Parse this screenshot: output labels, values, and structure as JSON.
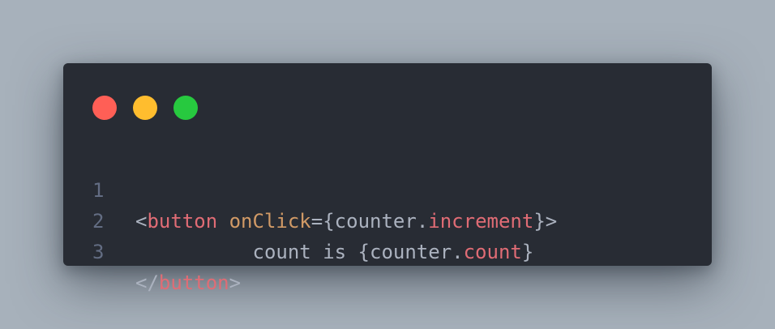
{
  "window": {
    "controls": [
      {
        "name": "close",
        "color": "#ff5f56"
      },
      {
        "name": "minimize",
        "color": "#ffbd2e"
      },
      {
        "name": "maximize",
        "color": "#27c93f"
      }
    ]
  },
  "code": {
    "lines": [
      {
        "number": "1",
        "tokens": {
          "open_bracket": "<",
          "tag": "button",
          "space": " ",
          "attr": "onClick",
          "equals_brace": "={",
          "obj": "counter",
          "dot": ".",
          "prop": "increment",
          "close": "}>"
        }
      },
      {
        "number": "2",
        "tokens": {
          "indent": "          ",
          "text": "count is {",
          "obj": "counter",
          "dot": ".",
          "prop": "count",
          "close": "}"
        }
      },
      {
        "number": "3",
        "tokens": {
          "open_bracket": "</",
          "tag": "button",
          "close": ">"
        }
      }
    ]
  },
  "colors": {
    "background": "#a7b1bb",
    "window": "#282c34",
    "line_number": "#636d83",
    "tag": "#e06c75",
    "attribute": "#d19a66",
    "plain": "#abb2bf"
  }
}
